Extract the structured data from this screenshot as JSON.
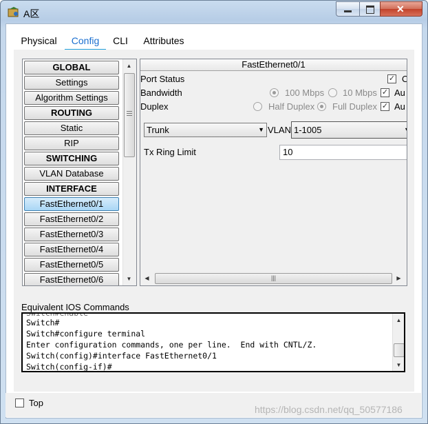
{
  "window": {
    "title": "A区"
  },
  "tabs": [
    {
      "label": "Physical"
    },
    {
      "label": "Config"
    },
    {
      "label": "CLI"
    },
    {
      "label": "Attributes"
    }
  ],
  "sidebar": {
    "items": [
      {
        "label": "GLOBAL",
        "kind": "header"
      },
      {
        "label": "Settings"
      },
      {
        "label": "Algorithm Settings"
      },
      {
        "label": "ROUTING",
        "kind": "header"
      },
      {
        "label": "Static"
      },
      {
        "label": "RIP"
      },
      {
        "label": "SWITCHING",
        "kind": "header"
      },
      {
        "label": "VLAN Database"
      },
      {
        "label": "INTERFACE",
        "kind": "header"
      },
      {
        "label": "FastEthernet0/1",
        "selected": true
      },
      {
        "label": "FastEthernet0/2"
      },
      {
        "label": "FastEthernet0/3"
      },
      {
        "label": "FastEthernet0/4"
      },
      {
        "label": "FastEthernet0/5"
      },
      {
        "label": "FastEthernet0/6"
      }
    ]
  },
  "detail": {
    "title": "FastEthernet0/1",
    "port_status_label": "Port Status",
    "port_status_on_text": "O",
    "bandwidth_label": "Bandwidth",
    "bw_100": "100 Mbps",
    "bw_10": "10 Mbps",
    "bw_auto": "Au",
    "duplex_label": "Duplex",
    "half_duplex": "Half Duplex",
    "full_duplex": "Full Duplex",
    "duplex_auto": "Au",
    "mode_value": "Trunk",
    "vlan_label": "VLAN",
    "vlan_value": "1-1005",
    "tx_label": "Tx Ring Limit",
    "tx_value": "10"
  },
  "ios": {
    "label": "Equivalent IOS Commands",
    "lines": [
      "Switch#",
      "Switch#configure terminal",
      "Enter configuration commands, one per line.  End with CNTL/Z.",
      "Switch(config)#interface FastEthernet0/1",
      "Switch(config-if)#"
    ]
  },
  "footer": {
    "top_label": "Top"
  },
  "watermark": "https://blog.csdn.net/qq_50577186"
}
